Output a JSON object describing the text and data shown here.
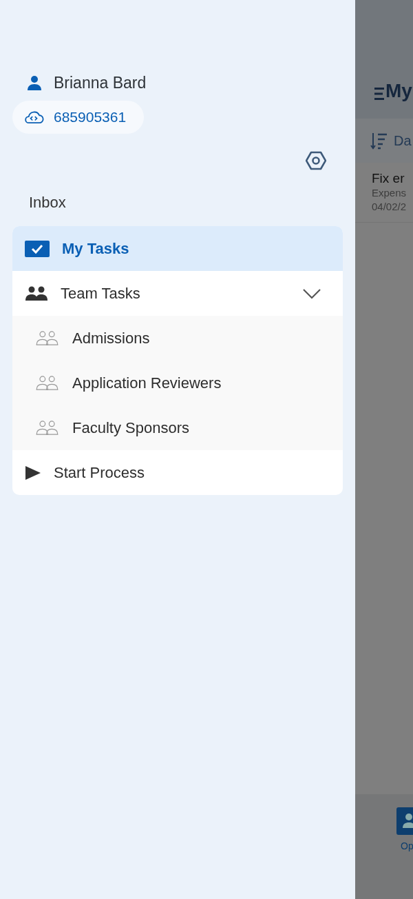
{
  "drawer": {
    "user_name": "Brianna Bard",
    "account": "685905361",
    "section": "Inbox",
    "items": [
      {
        "kind": "tasks",
        "label": "My Tasks",
        "selected": true
      },
      {
        "kind": "group",
        "label": "Team Tasks",
        "selected": false,
        "expanded": true,
        "children": [
          {
            "label": "Admissions",
            "selected": false
          },
          {
            "label": "Application Reviewers",
            "selected": false
          },
          {
            "label": "Faculty Sponsors",
            "selected": false
          }
        ]
      },
      {
        "kind": "start",
        "label": "Start Process",
        "selected": false
      }
    ]
  },
  "background": {
    "title": "My",
    "sort_label": "Da",
    "task": {
      "title": "Fix er",
      "subtitle": "Expens",
      "date": "04/02/2"
    },
    "bottom_button": "Op"
  }
}
